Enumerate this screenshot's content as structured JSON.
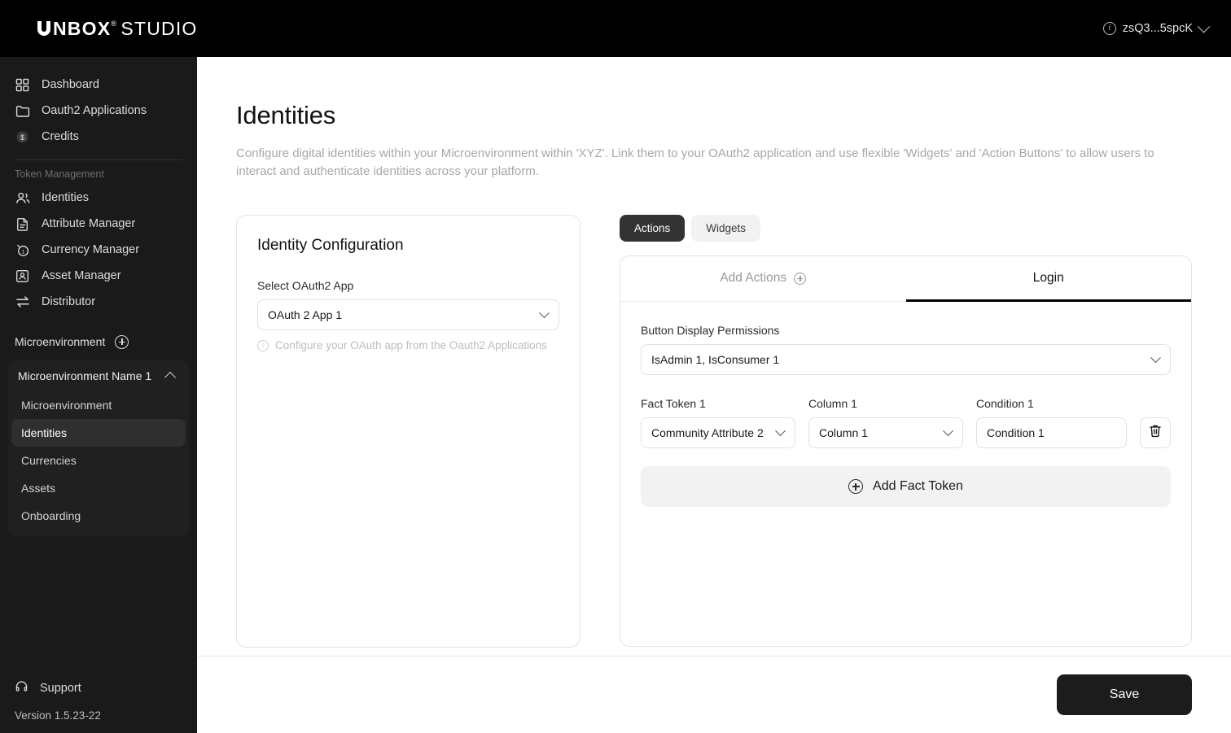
{
  "topbar": {
    "logo_mark": "U",
    "logo_bold": "NBOX",
    "logo_registered": "®",
    "logo_light": "STUDIO",
    "user_id": "zsQ3...5spcK",
    "info_glyph": "i"
  },
  "sidebar": {
    "primary_items": [
      {
        "label": "Dashboard",
        "icon": "grid-icon"
      },
      {
        "label": "Oauth2 Applications",
        "icon": "folder-icon"
      },
      {
        "label": "Credits",
        "icon": "coin-dollar-icon"
      }
    ],
    "section_label": "Token Management",
    "token_items": [
      {
        "label": "Identities",
        "icon": "people-icon"
      },
      {
        "label": "Attribute Manager",
        "icon": "document-icon"
      },
      {
        "label": "Currency Manager",
        "icon": "currency-circle-icon"
      },
      {
        "label": "Asset Manager",
        "icon": "asset-icon"
      },
      {
        "label": "Distributor",
        "icon": "transfer-arrows-icon"
      }
    ],
    "microenvironment_label": "Microenvironment",
    "group_title": "Microenvironment Name 1",
    "sub_items": [
      {
        "label": "Microenvironment",
        "active": false
      },
      {
        "label": "Identities",
        "active": true
      },
      {
        "label": "Currencies",
        "active": false
      },
      {
        "label": "Assets",
        "active": false
      },
      {
        "label": "Onboarding",
        "active": false
      }
    ],
    "support_label": "Support",
    "version": "Version 1.5.23-22"
  },
  "page": {
    "title": "Identities",
    "subtitle": "Configure digital identities within your Microenvironment within 'XYZ'. Link them to your OAuth2 application and use flexible 'Widgets' and 'Action Buttons' to allow users to interact and authenticate identities across your platform."
  },
  "identity_configuration": {
    "card_title": "Identity Configuration",
    "select_label": "Select OAuth2 App",
    "select_value": "OAuth 2 App 1",
    "hint": "Configure your OAuth app from the Oauth2 Applications",
    "hint_glyph": "i"
  },
  "segments": {
    "actions": "Actions",
    "widgets": "Widgets",
    "active": "Actions"
  },
  "tabs": [
    {
      "label": "Add Actions",
      "icon": "plus-circle-icon",
      "active": false
    },
    {
      "label": "Login",
      "icon": "",
      "active": true
    }
  ],
  "login_tab": {
    "permissions_label": "Button Display Permissions",
    "permissions_value": "IsAdmin 1, IsConsumer 1",
    "fact_token_label": "Fact Token 1",
    "fact_token_value": "Community Attribute 2",
    "column_label": "Column 1",
    "column_value": "Column 1",
    "condition_label": "Condition 1",
    "condition_value": "Condition 1",
    "delete_icon": "trash-icon",
    "add_fact_token": "Add Fact Token"
  },
  "footer": {
    "save_label": "Save"
  },
  "colors": {
    "topbar_bg": "#000000",
    "sidebar_bg": "#1a1a1a",
    "sidebar_active": "#2f2f2f",
    "accent_dark": "#1c1c1c",
    "seg_on_bg": "#333333",
    "seg_off_bg": "#f2f2f2",
    "muted_text": "#a8a8a8",
    "border": "#e4e4e4"
  }
}
